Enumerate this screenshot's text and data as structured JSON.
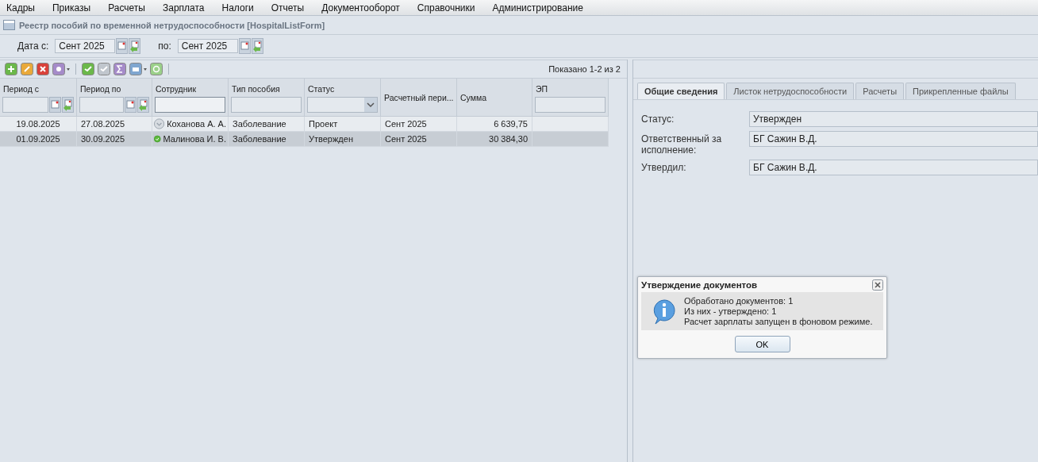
{
  "menu": [
    "Кадры",
    "Приказы",
    "Расчеты",
    "Зарплата",
    "Налоги",
    "Отчеты",
    "Документооборот",
    "Справочники",
    "Администрирование"
  ],
  "form_title": "Реестр пособий по временной нетрудоспособности [HospitalListForm]",
  "filter": {
    "from_label": "Дата с:",
    "from_value": "Сент 2025",
    "to_label": "по:",
    "to_value": "Сент 2025"
  },
  "grid": {
    "paging": "Показано 1-2 из 2",
    "columns": [
      {
        "label": "Период с",
        "kind": "date"
      },
      {
        "label": "Период по",
        "kind": "date"
      },
      {
        "label": "Сотрудник",
        "kind": "text"
      },
      {
        "label": "Тип пособия",
        "kind": "text"
      },
      {
        "label": "Статус",
        "kind": "select"
      },
      {
        "label": "Расчетный пери...",
        "kind": "plain"
      },
      {
        "label": "Сумма",
        "kind": "plain"
      },
      {
        "label": "ЭП",
        "kind": "text"
      }
    ],
    "rows": [
      {
        "selected": false,
        "approved": false,
        "cells": [
          "19.08.2025",
          "27.08.2025",
          "Коханова А. А.",
          "Заболевание",
          "Проект",
          "Сент 2025",
          "6 639,75"
        ]
      },
      {
        "selected": true,
        "approved": true,
        "cells": [
          "01.09.2025",
          "30.09.2025",
          "Малинова И. В.",
          "Заболевание",
          "Утвержден",
          "Сент 2025",
          "30 384,30"
        ]
      }
    ]
  },
  "detail": {
    "tabs": [
      {
        "label": "Общие сведения",
        "selected": true
      },
      {
        "label": "Листок нетрудоспособности",
        "selected": false
      },
      {
        "label": "Расчеты",
        "selected": false
      },
      {
        "label": "Прикрепленные файлы",
        "selected": false
      }
    ],
    "fields": [
      {
        "label": "Статус:",
        "value": "Утвержден"
      },
      {
        "label": "Ответственный за исполнение:",
        "value": "БГ Сажин В.Д."
      },
      {
        "label": "Утвердил:",
        "value": "БГ Сажин В.Д."
      }
    ]
  },
  "dialog": {
    "title": "Утверждение документов",
    "lines": [
      "Обработано документов: 1",
      "Из них - утверждено: 1",
      "Расчет зарплаты запущен в фоновом режиме."
    ],
    "button": "OK"
  }
}
